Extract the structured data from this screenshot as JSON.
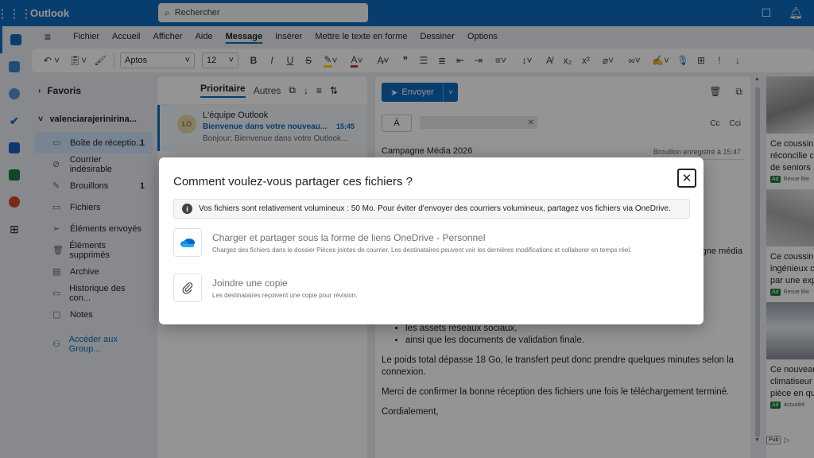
{
  "app": {
    "name": "Outlook"
  },
  "search": {
    "placeholder": "Rechercher"
  },
  "menu": {
    "tabs": [
      "Fichier",
      "Accueil",
      "Afficher",
      "Aide",
      "Message",
      "Insérer",
      "Mettre le texte en forme",
      "Dessiner",
      "Options"
    ],
    "active_tab": "Message"
  },
  "toolbar": {
    "font": "Aptos",
    "size": "12"
  },
  "folders": {
    "favorites_label": "Favoris",
    "account": "valenciarajerinirina...",
    "items": [
      {
        "label": "Boîte de réceptio...",
        "icon": "inbox-icon",
        "count": "1"
      },
      {
        "label": "Courrier indésirable",
        "icon": "junk-icon",
        "count": ""
      },
      {
        "label": "Brouillons",
        "icon": "drafts-icon",
        "count": "1"
      },
      {
        "label": "Fichiers",
        "icon": "folder-icon",
        "count": ""
      },
      {
        "label": "Éléments envoyés",
        "icon": "sent-icon",
        "count": ""
      },
      {
        "label": "Éléments supprimés",
        "icon": "trash-icon",
        "count": ""
      },
      {
        "label": "Archive",
        "icon": "archive-icon",
        "count": ""
      },
      {
        "label": "Historique des con...",
        "icon": "folder-icon",
        "count": ""
      },
      {
        "label": "Notes",
        "icon": "notes-icon",
        "count": ""
      }
    ],
    "groups_link": "Accéder aux Group..."
  },
  "message_list": {
    "tab_focused": "Prioritaire",
    "tab_other": "Autres",
    "messages": [
      {
        "initials": "LO",
        "from": "L'équipe Outlook",
        "subject": "Bienvenue dans votre nouveau...",
        "time": "15:45",
        "preview": "Bonjour; Bienvenue dans votre Outlook..."
      }
    ]
  },
  "compose": {
    "send_label": "Envoyer",
    "to_label": "À",
    "cc": "Cc",
    "bcc": "Cci",
    "subject": "Campagne Média 2026",
    "draft_status": "Brouillon enregistré à 15:47",
    "body_fragment": "gne média",
    "bullets": [
      "les assets réseaux sociaux,",
      "ainsi que les documents de validation finale."
    ],
    "paragraphs": [
      "Le poids total dépasse 18 Go, le transfert peut donc prendre quelques minutes selon la connexion.",
      "Merci de confirmer la bonne réception des fichiers une fois le téléchargement terminé.",
      "Cordialement,"
    ]
  },
  "ads": [
    {
      "text": [
        "Ce coussin",
        "réconcilie c",
        "de seniors"
      ],
      "badge": "Ad",
      "source": "Revue Bie"
    },
    {
      "text": [
        "Ce coussin",
        "ingénieux c",
        "par une exp"
      ],
      "badge": "Ad",
      "source": "Revue Bie"
    },
    {
      "text": [
        "Ce nouveau",
        "climatiseur",
        "pièce en qu"
      ],
      "badge": "Ad",
      "source": "Actualité"
    }
  ],
  "ads_footer": "Pub",
  "dialog": {
    "title": "Comment voulez-vous partager ces fichiers ?",
    "warning": "Vos fichiers sont relativement volumineux :  50 Mo. Pour éviter d'envoyer des courriers volumineux, partagez vos fichiers via OneDrive.",
    "options": [
      {
        "title": "Charger et partager sous la forme de liens OneDrive - Personnel",
        "desc": "Chargez des fichiers dans le dossier Pièces jointes de courrier. Les destinataires peuvent voir les dernières modifications et collaborer en temps réel.",
        "icon": "onedrive-cloud-icon"
      },
      {
        "title": "Joindre une copie",
        "desc": "Les destinataires reçoivent une copie pour révision.",
        "icon": "paperclip-icon"
      }
    ]
  },
  "colors": {
    "brand": "#0f6cbd",
    "onedrive": "#0a64d6",
    "ad_badge": "#1e7a34"
  }
}
